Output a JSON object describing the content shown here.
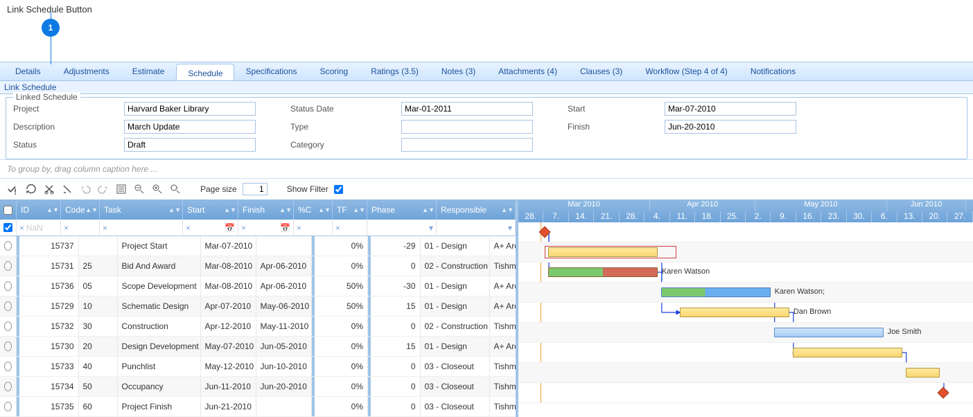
{
  "header": {
    "title": "Link Schedule Button",
    "callout": "1"
  },
  "tabs": [
    "Details",
    "Adjustments",
    "Estimate",
    "Schedule",
    "Specifications",
    "Scoring",
    "Ratings (3.5)",
    "Notes (3)",
    "Attachments (4)",
    "Clauses (3)",
    "Workflow (Step 4 of 4)",
    "Notifications"
  ],
  "tabs_active_index": 3,
  "link_button": "Link Schedule",
  "fieldset": {
    "legend": "Linked Schedule",
    "project_label": "Project",
    "project_value": "Harvard Baker Library",
    "description_label": "Description",
    "description_value": "March Update",
    "status_label": "Status",
    "status_value": "Draft",
    "status_date_label": "Status Date",
    "status_date_value": "Mar-01-2011",
    "type_label": "Type",
    "type_value": "",
    "category_label": "Category",
    "category_value": "",
    "start_label": "Start",
    "start_value": "Mar-07-2010",
    "finish_label": "Finish",
    "finish_value": "Jun-20-2010"
  },
  "groupbar": "To group by, drag column caption here ...",
  "toolbar": {
    "page_size_label": "Page size",
    "page_size_value": "1",
    "show_filter_label": "Show Filter",
    "show_filter_checked": true
  },
  "columns": {
    "id": "ID",
    "code": "Code",
    "task": "Task",
    "start": "Start",
    "finish": "Finish",
    "pc": "%C",
    "tf": "TF",
    "phase": "Phase",
    "resp": "Responsible"
  },
  "filter_nan": "NaN",
  "rows": [
    {
      "id": "15737",
      "code": "",
      "task": "Project Start",
      "start": "Mar-07-2010",
      "finish": "",
      "pc": "0%",
      "tf": "-29",
      "phase": "01 - Design",
      "resp": "A+ Architects"
    },
    {
      "id": "15731",
      "code": "25",
      "task": "Bid And Award",
      "start": "Mar-08-2010",
      "finish": "Apr-06-2010",
      "pc": "0%",
      "tf": "0",
      "phase": "02 - Construction",
      "resp": "Tishman Construct"
    },
    {
      "id": "15736",
      "code": "05",
      "task": "Scope Development",
      "start": "Mar-08-2010",
      "finish": "Apr-06-2010",
      "pc": "50%",
      "tf": "-30",
      "phase": "01 - Design",
      "resp": "A+ Architects"
    },
    {
      "id": "15729",
      "code": "10",
      "task": "Schematic Design",
      "start": "Apr-07-2010",
      "finish": "May-06-2010",
      "pc": "50%",
      "tf": "15",
      "phase": "01 - Design",
      "resp": "A+ Architects"
    },
    {
      "id": "15732",
      "code": "30",
      "task": "Construction",
      "start": "Apr-12-2010",
      "finish": "May-11-2010",
      "pc": "0%",
      "tf": "0",
      "phase": "02 - Construction",
      "resp": "Tishman Construct"
    },
    {
      "id": "15730",
      "code": "20",
      "task": "Design Development",
      "start": "May-07-2010",
      "finish": "Jun-05-2010",
      "pc": "0%",
      "tf": "15",
      "phase": "01 - Design",
      "resp": "A+ Architects"
    },
    {
      "id": "15733",
      "code": "40",
      "task": "Punchlist",
      "start": "May-12-2010",
      "finish": "Jun-10-2010",
      "pc": "0%",
      "tf": "0",
      "phase": "03 - Closeout",
      "resp": "Tishman Construct"
    },
    {
      "id": "15734",
      "code": "50",
      "task": "Occupancy",
      "start": "Jun-11-2010",
      "finish": "Jun-20-2010",
      "pc": "0%",
      "tf": "0",
      "phase": "03 - Closeout",
      "resp": "Tishman Construct"
    },
    {
      "id": "15735",
      "code": "60",
      "task": "Project Finish",
      "start": "Jun-21-2010",
      "finish": "",
      "pc": "0%",
      "tf": "0",
      "phase": "03 - Closeout",
      "resp": "Tishman Construct"
    }
  ],
  "timeline": {
    "months": [
      {
        "label": "Mar 2010",
        "span": 5
      },
      {
        "label": "Apr 2010",
        "span": 4
      },
      {
        "label": "May 2010",
        "span": 5
      },
      {
        "label": "Jun 2010",
        "span": 3
      }
    ],
    "days": [
      "28.",
      "7.",
      "14.",
      "21.",
      "28.",
      "4.",
      "11.",
      "18.",
      "25.",
      "2.",
      "9.",
      "16.",
      "23.",
      "30.",
      "6.",
      "13.",
      "20.",
      "27."
    ]
  },
  "bar_labels": {
    "karen": "Karen Watson",
    "karen2": "Karen Watson;",
    "dan": "Dan Brown",
    "joe": "Joe Smith"
  },
  "chart_data": {
    "type": "gantt",
    "x_axis": {
      "start": "2010-02-28",
      "end": "2010-06-27",
      "unit": "day"
    },
    "today": "2010-03-07",
    "tasks": [
      {
        "id": 15737,
        "name": "Project Start",
        "type": "milestone",
        "date": "2010-03-07"
      },
      {
        "id": 15731,
        "name": "Bid And Award",
        "start": "2010-03-08",
        "finish": "2010-04-06",
        "pct_complete": 0,
        "baseline_start": "2010-03-07",
        "baseline_finish": "2010-04-11"
      },
      {
        "id": 15736,
        "name": "Scope Development",
        "start": "2010-03-08",
        "finish": "2010-04-06",
        "pct_complete": 50,
        "resource": "Karen Watson"
      },
      {
        "id": 15729,
        "name": "Schematic Design",
        "start": "2010-04-07",
        "finish": "2010-05-06",
        "pct_complete": 50,
        "resource": "Karen Watson;"
      },
      {
        "id": 15732,
        "name": "Construction",
        "start": "2010-04-12",
        "finish": "2010-05-11",
        "pct_complete": 0,
        "resource": "Dan Brown"
      },
      {
        "id": 15730,
        "name": "Design Development",
        "start": "2010-05-07",
        "finish": "2010-06-05",
        "pct_complete": 0,
        "resource": "Joe Smith"
      },
      {
        "id": 15733,
        "name": "Punchlist",
        "start": "2010-05-12",
        "finish": "2010-06-10",
        "pct_complete": 0
      },
      {
        "id": 15734,
        "name": "Occupancy",
        "start": "2010-06-11",
        "finish": "2010-06-20",
        "pct_complete": 0
      },
      {
        "id": 15735,
        "name": "Project Finish",
        "type": "milestone",
        "date": "2010-06-21"
      }
    ],
    "links": [
      {
        "from": 15737,
        "to": 15731
      },
      {
        "from": 15737,
        "to": 15736
      },
      {
        "from": 15731,
        "to": 15732
      },
      {
        "from": 15736,
        "to": 15729
      },
      {
        "from": 15729,
        "to": 15730
      },
      {
        "from": 15732,
        "to": 15733
      },
      {
        "from": 15733,
        "to": 15734
      },
      {
        "from": 15734,
        "to": 15735
      }
    ]
  }
}
